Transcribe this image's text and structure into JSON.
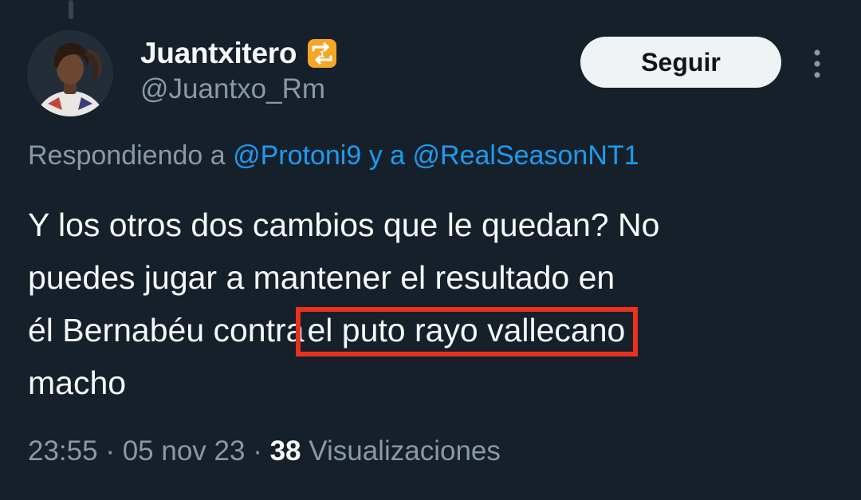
{
  "author": {
    "display_name": "Juantxitero",
    "handle": "@Juantxo_Rm",
    "badge": "retweet-one-badge-icon"
  },
  "actions": {
    "follow_label": "Seguir",
    "more_icon": "vertical-ellipsis-icon"
  },
  "reply": {
    "prefix": "Respondiendo a",
    "mention_1": "@Protoni9",
    "connector": "y a",
    "mention_2": "@RealSeasonNT1"
  },
  "tweet": {
    "line_1": "Y los otros dos cambios que le quedan? No",
    "line_2": "puedes jugar a mantener el resultado en",
    "line_3_before": "él Bernabéu contra",
    "line_3_highlight": "el puto rayo vallecano",
    "line_4": "macho"
  },
  "meta": {
    "time": "23:55",
    "sep_1": "·",
    "date": "05 nov 23",
    "sep_2": "·",
    "views_count": "38",
    "views_label": "Visualizaciones"
  },
  "colors": {
    "background": "#15202b",
    "text": "#f7f9f9",
    "secondary_text": "#8b98a5",
    "link": "#1d9bf0",
    "highlight_box": "#e8321f",
    "badge_orange": "#f5a623"
  }
}
